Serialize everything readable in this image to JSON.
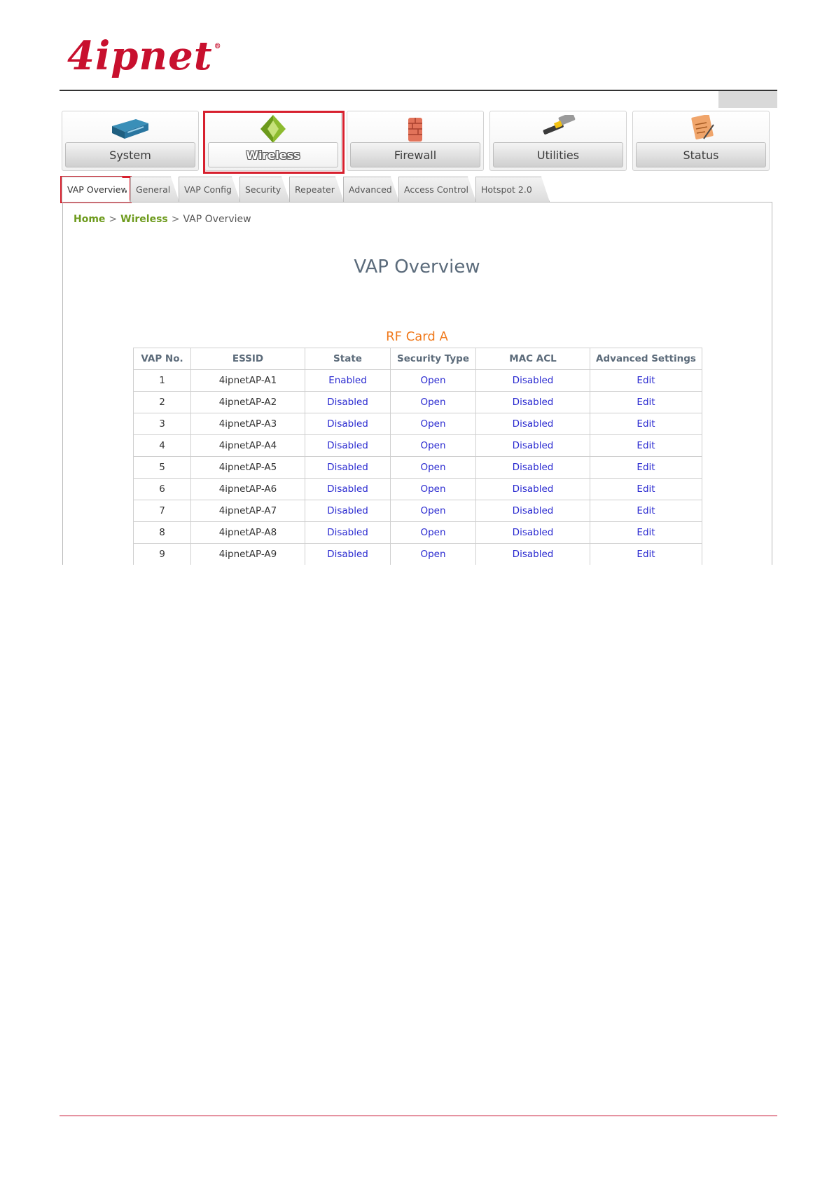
{
  "logo": {
    "text": "4ipnet",
    "mark": "®"
  },
  "main_nav": [
    {
      "label": "System",
      "icon": "switch-icon"
    },
    {
      "label": "Wireless",
      "icon": "wireless-icon"
    },
    {
      "label": "Firewall",
      "icon": "firewall-icon"
    },
    {
      "label": "Utilities",
      "icon": "hammer-icon"
    },
    {
      "label": "Status",
      "icon": "clipboard-icon"
    }
  ],
  "tabs": [
    {
      "label": "VAP Overview"
    },
    {
      "label": "General"
    },
    {
      "label": "VAP Config"
    },
    {
      "label": "Security"
    },
    {
      "label": "Repeater"
    },
    {
      "label": "Advanced"
    },
    {
      "label": "Access Control"
    },
    {
      "label": "Hotspot 2.0"
    }
  ],
  "breadcrumb": {
    "home": "Home",
    "section": "Wireless",
    "sep": ">",
    "current": "VAP Overview"
  },
  "page_title": "VAP Overview",
  "card_title": "RF Card A",
  "table": {
    "headers": [
      "VAP No.",
      "ESSID",
      "State",
      "Security Type",
      "MAC ACL",
      "Advanced Settings"
    ],
    "rows": [
      [
        "1",
        "4ipnetAP-A1",
        "Enabled",
        "Open",
        "Disabled",
        "Edit"
      ],
      [
        "2",
        "4ipnetAP-A2",
        "Disabled",
        "Open",
        "Disabled",
        "Edit"
      ],
      [
        "3",
        "4ipnetAP-A3",
        "Disabled",
        "Open",
        "Disabled",
        "Edit"
      ],
      [
        "4",
        "4ipnetAP-A4",
        "Disabled",
        "Open",
        "Disabled",
        "Edit"
      ],
      [
        "5",
        "4ipnetAP-A5",
        "Disabled",
        "Open",
        "Disabled",
        "Edit"
      ],
      [
        "6",
        "4ipnetAP-A6",
        "Disabled",
        "Open",
        "Disabled",
        "Edit"
      ],
      [
        "7",
        "4ipnetAP-A7",
        "Disabled",
        "Open",
        "Disabled",
        "Edit"
      ],
      [
        "8",
        "4ipnetAP-A8",
        "Disabled",
        "Open",
        "Disabled",
        "Edit"
      ],
      [
        "9",
        "4ipnetAP-A9",
        "Disabled",
        "Open",
        "Disabled",
        "Edit"
      ]
    ]
  },
  "colors": {
    "brand": "#c8102e",
    "highlight": "#d7202e",
    "link": "#2a2ad0",
    "crumb": "#6e9b1e",
    "card_title": "#f07a1d"
  }
}
